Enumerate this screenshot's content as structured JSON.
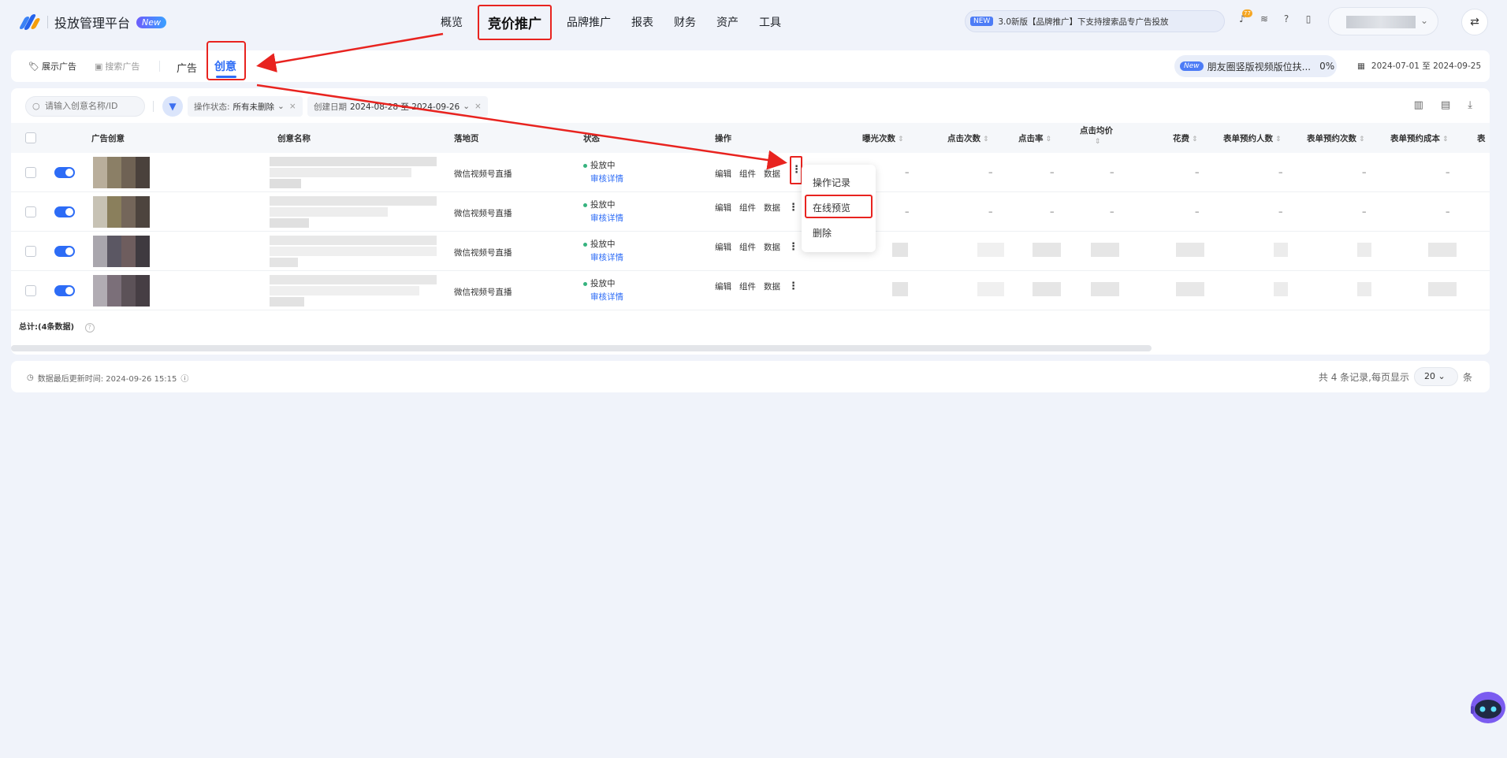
{
  "header": {
    "app_name": "投放管理平台",
    "new_badge": "New",
    "nav": [
      {
        "label": "概览",
        "active": false
      },
      {
        "label": "竞价推广",
        "active": true
      },
      {
        "label": "品牌推广",
        "active": false
      },
      {
        "label": "报表",
        "active": false
      },
      {
        "label": "财务",
        "active": false
      },
      {
        "label": "资产",
        "active": false
      },
      {
        "label": "工具",
        "active": false
      }
    ],
    "announcement_tag": "NEW",
    "announcement": "3.0新版【品牌推广】下支持搜索品专广告投放",
    "notification_count": "77"
  },
  "tabs": {
    "display_ads": "展示广告",
    "search_ads": "搜索广告",
    "ad": "广告",
    "creative": "创意",
    "promo_tag": "New",
    "promo_text": "朋友圈竖版视频版位扶...",
    "promo_pct": "0%",
    "date_range": "2024-07-01 至 2024-09-25"
  },
  "filters": {
    "search_placeholder": "请输入创意名称/ID",
    "status_label": "操作状态:",
    "status_value": "所有未删除",
    "date_label": "创建日期",
    "date_value": "2024-08-28 至 2024-09-26"
  },
  "table": {
    "headers": {
      "creative": "广告创意",
      "name": "创意名称",
      "landing": "落地页",
      "status": "状态",
      "ops": "操作",
      "impressions": "曝光次数",
      "clicks": "点击次数",
      "ctr": "点击率",
      "cpc": "点击均价",
      "cost": "花费",
      "form_users": "表单预约人数",
      "form_count": "表单预约次数",
      "form_cost": "表单预约成本",
      "more": "表"
    },
    "rows": [
      {
        "landing": "微信视频号直播",
        "status": "投放中",
        "review": "审核详情",
        "empty": "–"
      },
      {
        "landing": "微信视频号直播",
        "status": "投放中",
        "review": "审核详情",
        "empty": "–"
      },
      {
        "landing": "微信视频号直播",
        "status": "投放中",
        "review": "审核详情",
        "empty": ""
      },
      {
        "landing": "微信视频号直播",
        "status": "投放中",
        "review": "审核详情",
        "empty": ""
      }
    ],
    "ops_labels": {
      "edit": "编辑",
      "component": "组件",
      "data": "数据"
    },
    "total": "总计:(4条数据)"
  },
  "menu": {
    "items": [
      "操作记录",
      "在线预览",
      "删除"
    ]
  },
  "footer": {
    "updated": "数据最后更新时间: 2024-09-26 15:15",
    "records": "共 4 条记录,每页显示",
    "page_size": "20",
    "unit": "条"
  },
  "colors": {
    "accent": "#2d6cf6",
    "annotation": "#e8231f",
    "background": "#f0f3fa"
  }
}
